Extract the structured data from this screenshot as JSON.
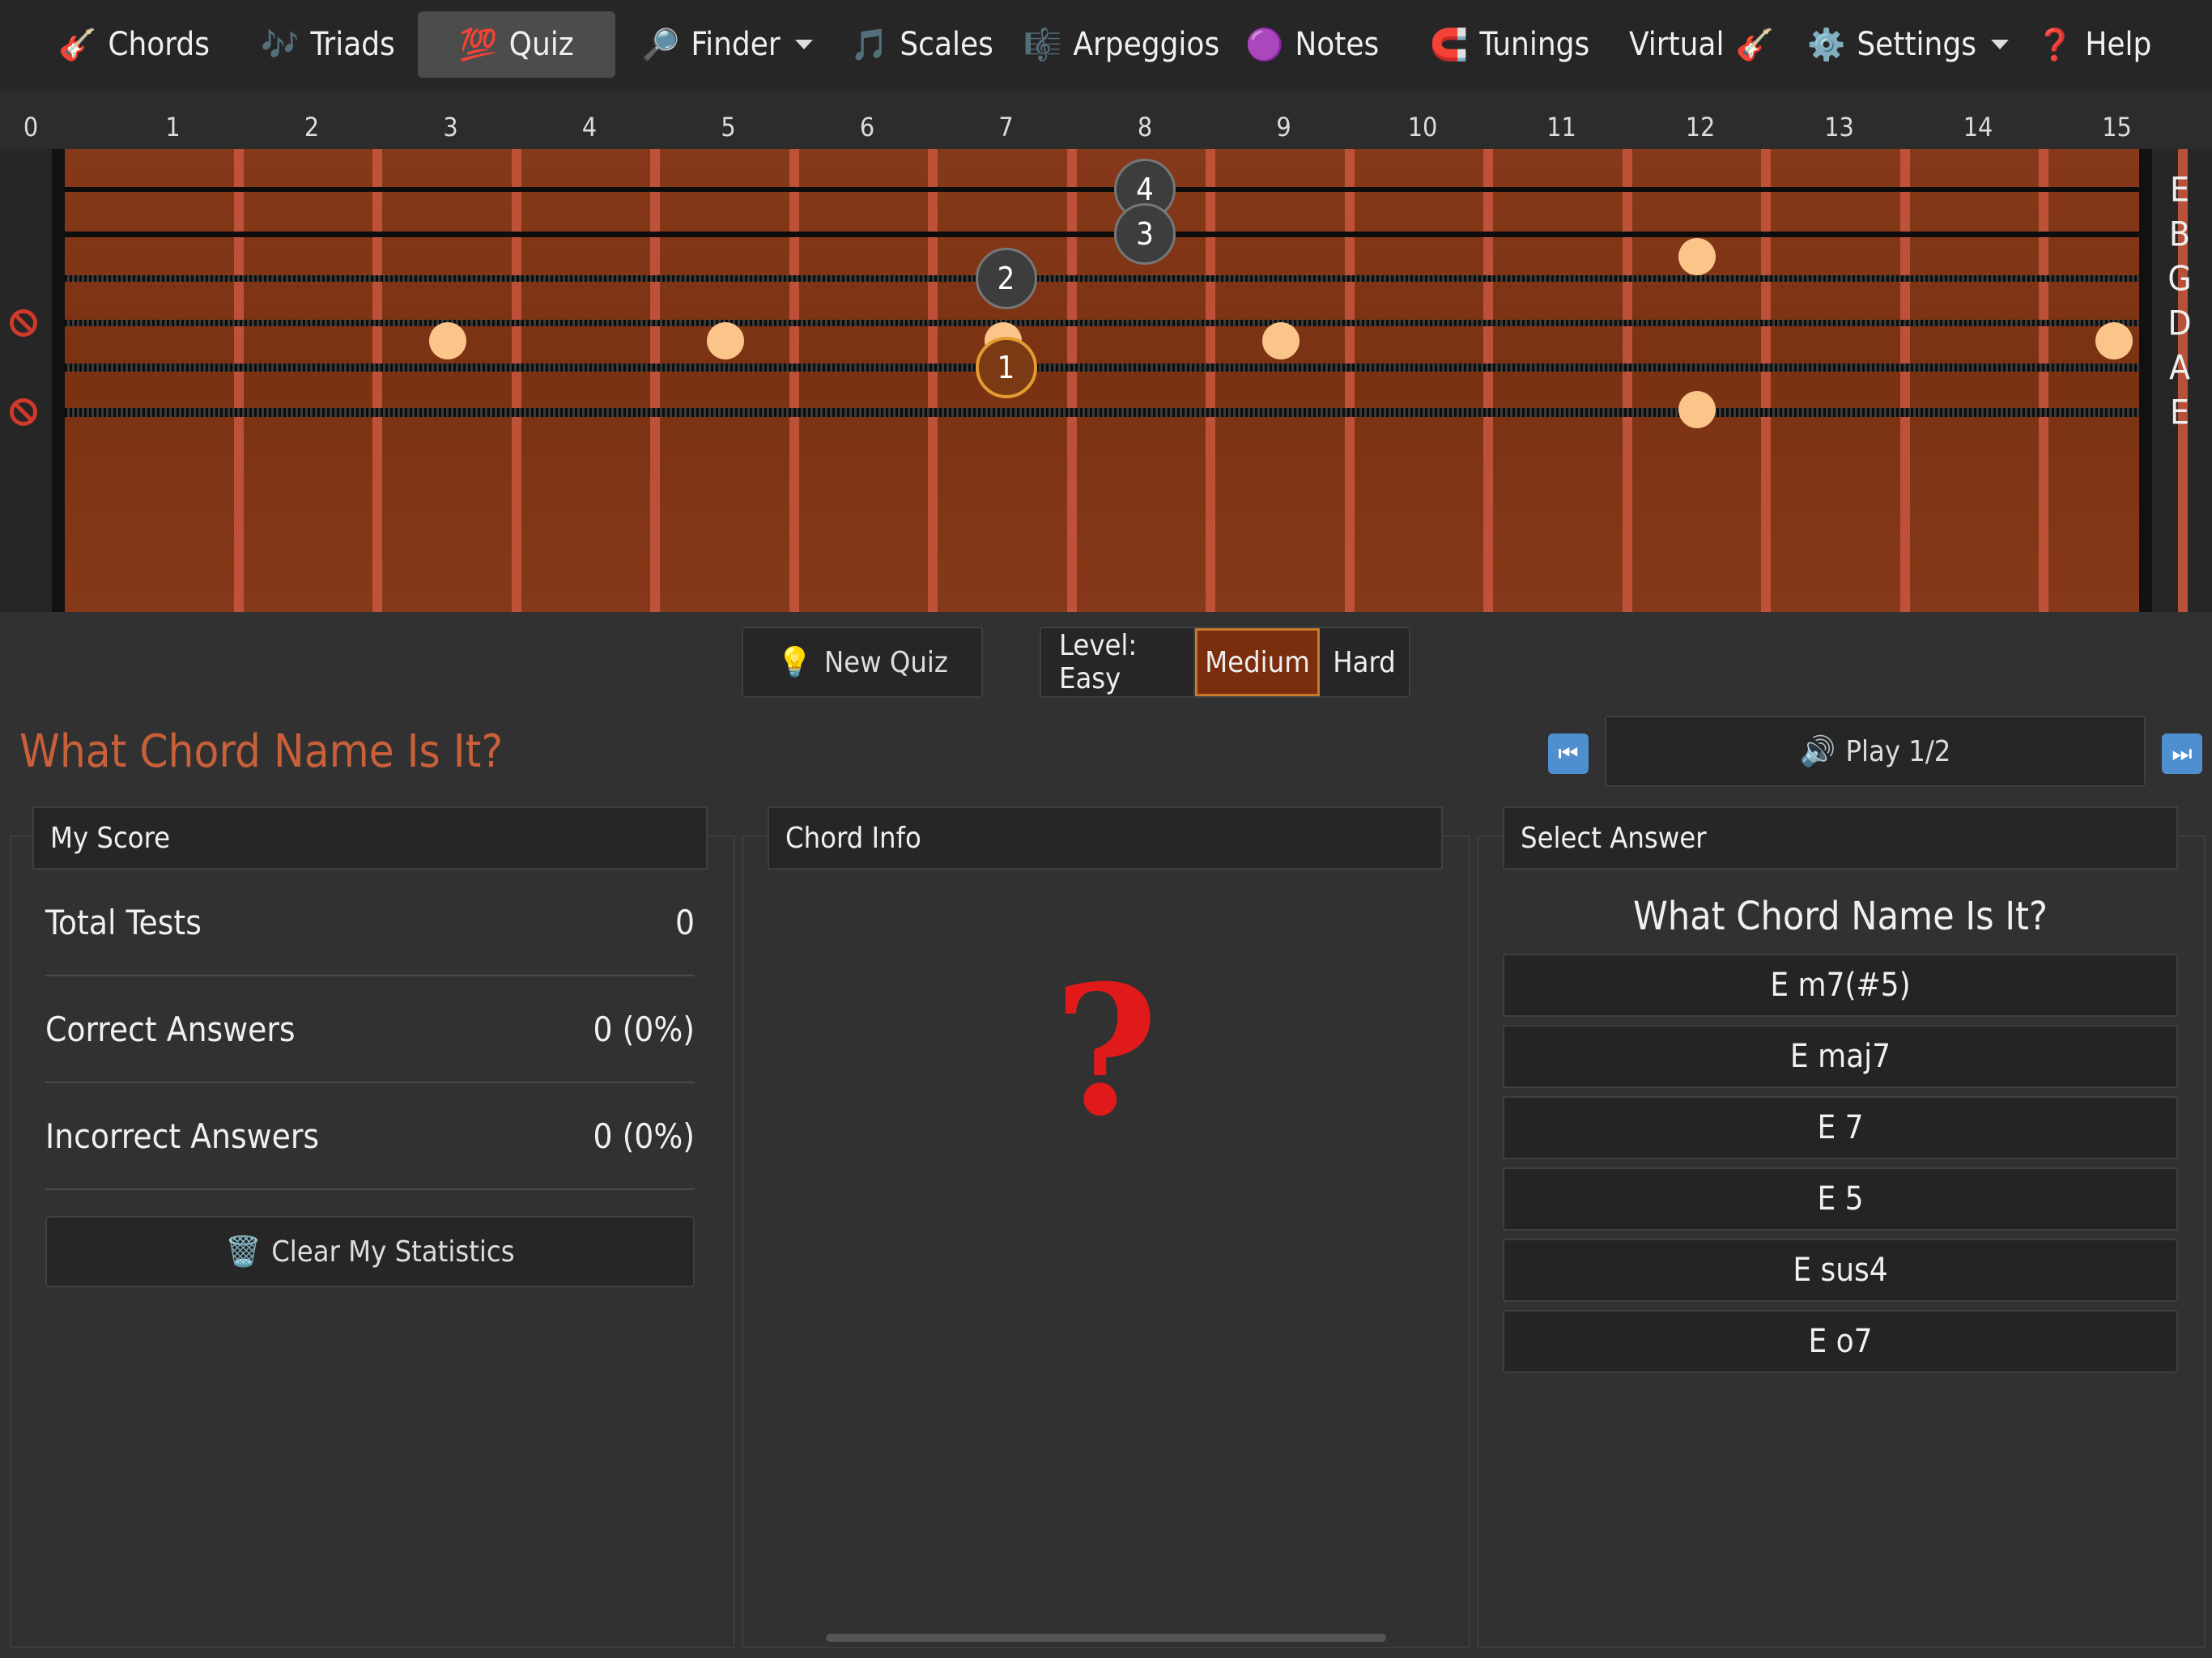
{
  "nav": {
    "items": [
      {
        "label": "Chords",
        "icon": "🎸",
        "name": "chords"
      },
      {
        "label": "Triads",
        "icon": "🎶",
        "name": "triads"
      },
      {
        "label": "Quiz",
        "icon": "💯",
        "name": "quiz",
        "active": true
      },
      {
        "label": "Finder",
        "icon": "🔎",
        "name": "finder",
        "dropdown": true
      },
      {
        "label": "Scales",
        "icon": "🎵",
        "name": "scales"
      },
      {
        "label": "Arpeggios",
        "icon": "🎼",
        "name": "arpeggios"
      },
      {
        "label": "Notes",
        "icon": "🟣",
        "name": "notes"
      },
      {
        "label": "Tunings",
        "icon": "🧲",
        "name": "tunings"
      },
      {
        "label": "Virtual",
        "icon": "🎸",
        "name": "virtual",
        "icon_after": true
      },
      {
        "label": "Settings",
        "icon": "⚙️",
        "name": "settings",
        "dropdown": true
      },
      {
        "label": "Help",
        "icon": "❓",
        "name": "help"
      }
    ]
  },
  "fretboard": {
    "fret_numbers": [
      "0",
      "1",
      "2",
      "3",
      "4",
      "5",
      "6",
      "7",
      "8",
      "9",
      "10",
      "11",
      "12",
      "13",
      "14",
      "15"
    ],
    "strings": [
      "E",
      "B",
      "G",
      "D",
      "A",
      "E"
    ],
    "muted_strings": [
      3,
      5
    ],
    "fingers": [
      {
        "string": 0,
        "fret": 8,
        "label": "4"
      },
      {
        "string": 1,
        "fret": 8,
        "label": "3"
      },
      {
        "string": 2,
        "fret": 7,
        "label": "2"
      },
      {
        "string": 4,
        "fret": 7,
        "label": "1",
        "root": true
      }
    ]
  },
  "controls": {
    "new_quiz": "New Quiz",
    "level_label": "Level: Easy",
    "level_medium": "Medium",
    "level_hard": "Hard",
    "play_label": "Play 1/2"
  },
  "quiz": {
    "title": "What Chord Name Is It?",
    "chord_info_placeholder": "?"
  },
  "score": {
    "header": "My Score",
    "rows": [
      {
        "label": "Total Tests",
        "value": "0"
      },
      {
        "label": "Correct Answers",
        "value": "0 (0%)"
      },
      {
        "label": "Incorrect Answers",
        "value": "0 (0%)"
      }
    ],
    "clear_button": "Clear My Statistics"
  },
  "chord_info": {
    "header": "Chord Info"
  },
  "answers": {
    "header": "Select Answer",
    "question": "What Chord Name Is It?",
    "options": [
      "E m7(#5)",
      "E maj7",
      "E 7",
      "E 5",
      "E sus4",
      "E o7"
    ]
  },
  "colors": {
    "accent": "#c9603a",
    "selected": "#7a2e0d",
    "fretboard": "#86391a",
    "inlay": "#fbc58a"
  }
}
